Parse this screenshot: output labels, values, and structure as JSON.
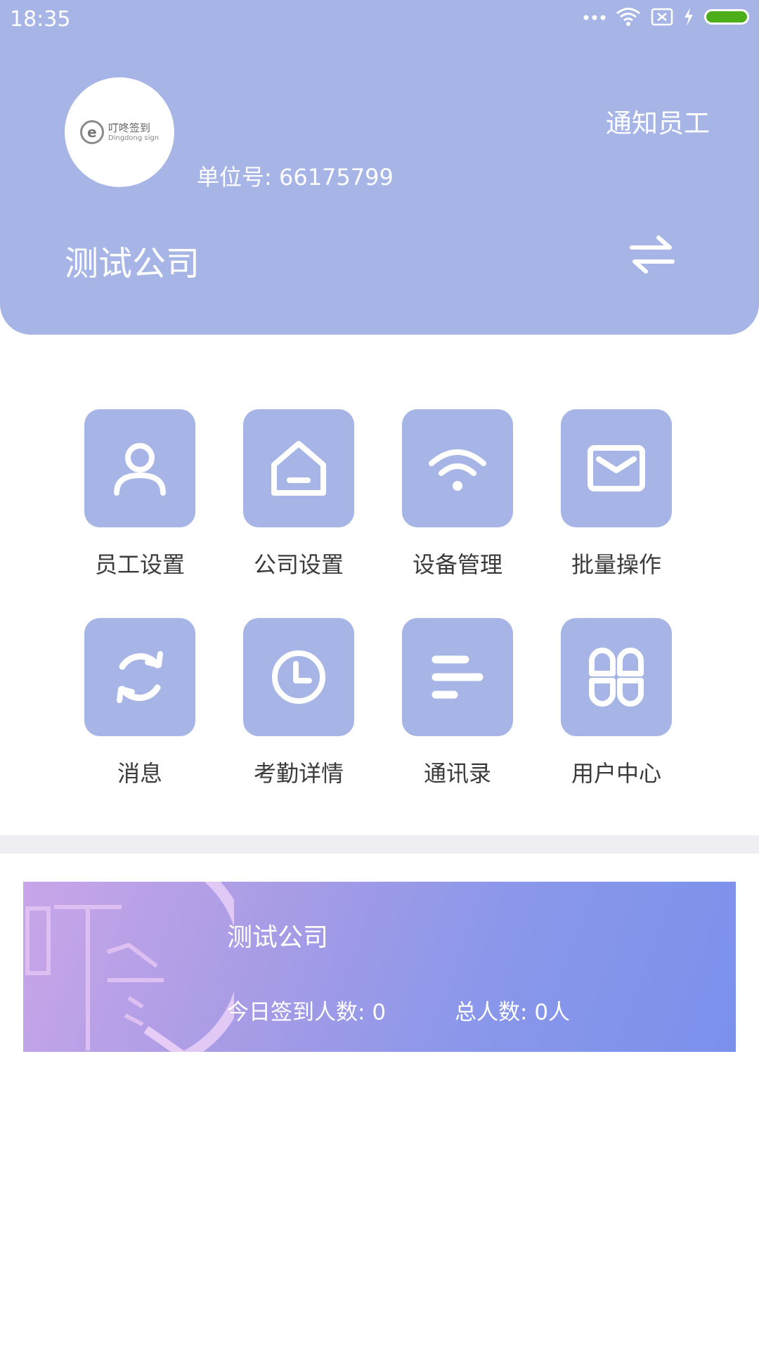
{
  "status_bar": {
    "time": "18:35",
    "icons": [
      "more-dots-icon",
      "wifi-icon",
      "sim-off-icon",
      "charging-icon",
      "battery-icon"
    ]
  },
  "header": {
    "logo": {
      "text_cn": "叮咚签到",
      "text_en": "Dingdong sign"
    },
    "notify_label": "通知员工",
    "unit_label": "单位号:",
    "unit_number": "66175799",
    "company_name": "测试公司",
    "switch_icon": "swap-arrows-icon"
  },
  "grid": {
    "items": [
      {
        "label": "员工设置",
        "icon": "person-icon"
      },
      {
        "label": "公司设置",
        "icon": "house-icon"
      },
      {
        "label": "设备管理",
        "icon": "wifi-icon"
      },
      {
        "label": "批量操作",
        "icon": "mail-icon"
      },
      {
        "label": "消息",
        "icon": "refresh-icon"
      },
      {
        "label": "考勤详情",
        "icon": "clock-icon"
      },
      {
        "label": "通讯录",
        "icon": "list-icon"
      },
      {
        "label": "用户中心",
        "icon": "apps-icon"
      }
    ]
  },
  "banner": {
    "title": "测试公司",
    "checkin_label": "今日签到人数:",
    "checkin_count": "0",
    "total_label": "总人数:",
    "total_count": "0人"
  },
  "colors": {
    "primary": "#a6b5e6",
    "label_text": "#3b3b3b",
    "divider": "#efeef3",
    "battery": "#4caf1a"
  }
}
